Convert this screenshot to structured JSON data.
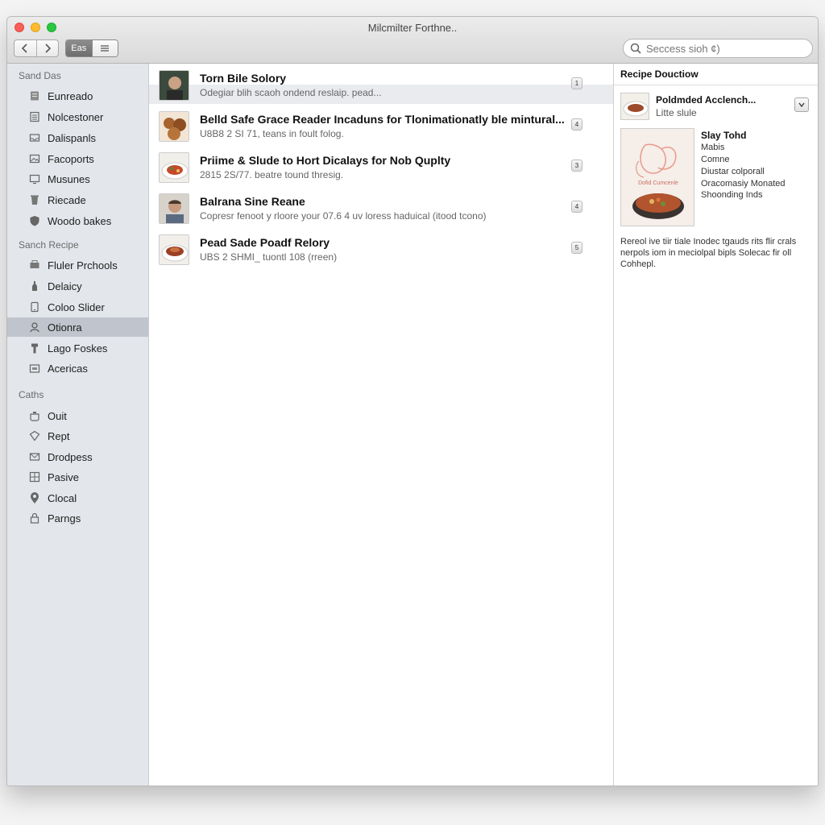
{
  "window": {
    "title": "Milcmilter Forthne.."
  },
  "toolbar": {
    "back_icon": "chevron-left-icon",
    "forward_icon": "chevron-right-icon",
    "view_active_label": "Eas",
    "view_inactive_icon": "list-icon"
  },
  "search": {
    "placeholder": "Seccess sioh ¢)"
  },
  "sidebar": {
    "sections": [
      {
        "header": "Sand Das",
        "items": [
          {
            "label": "Eunreado",
            "icon": "book-icon"
          },
          {
            "label": "Nolcestoner",
            "icon": "document-icon"
          },
          {
            "label": "Dalispanls",
            "icon": "tray-icon"
          },
          {
            "label": "Facoports",
            "icon": "image-icon"
          },
          {
            "label": "Musunes",
            "icon": "monitor-icon"
          },
          {
            "label": "Riecade",
            "icon": "bin-icon"
          },
          {
            "label": "Woodo bakes",
            "icon": "shield-icon"
          }
        ]
      },
      {
        "header": "Sanch Recipe",
        "items": [
          {
            "label": "Fluler Prchools",
            "icon": "printer-icon"
          },
          {
            "label": "Delaicy",
            "icon": "bottle-icon"
          },
          {
            "label": "Coloo Slider",
            "icon": "phone-icon"
          },
          {
            "label": "Otionra",
            "icon": "person-icon",
            "selected": true
          },
          {
            "label": "Lago Foskes",
            "icon": "chef-icon"
          },
          {
            "label": "Acericas",
            "icon": "box-icon"
          }
        ]
      },
      {
        "header": "Caths",
        "items": [
          {
            "label": "Ouit",
            "icon": "pot-icon"
          },
          {
            "label": "Rept",
            "icon": "tag-icon"
          },
          {
            "label": "Drodpess",
            "icon": "mail-icon"
          },
          {
            "label": "Pasive",
            "icon": "grid-icon"
          },
          {
            "label": "Clocal",
            "icon": "pin-icon"
          },
          {
            "label": "Parngs",
            "icon": "lock-icon"
          }
        ]
      }
    ]
  },
  "list": {
    "rows": [
      {
        "title": "Torn Bile Solory",
        "subtitle": "Odegiar blih scaoh ondend reslaip. pead...",
        "badge": "1",
        "thumb": "person",
        "highlight": true
      },
      {
        "title": "Belld Safe Grace Reader Incaduns for Tlonimationatly ble mintural...",
        "subtitle": "U8B8 2 SI 71, teans in foult folog.",
        "badge": "4",
        "thumb": "food-brown"
      },
      {
        "title": "Priime & Slude to Hort Dicalays for Nob Quplty",
        "subtitle": "2815 2S/77. beatre tound thresig.",
        "badge": "3",
        "thumb": "food-plate"
      },
      {
        "title": "Balrana Sine Reane",
        "subtitle": "Copresr fenoot y rloore your 07.6 4 uv loress haduical (itood tcono)",
        "badge": "4",
        "thumb": "person2"
      },
      {
        "title": "Pead Sade Poadf Relory",
        "subtitle": "UBS 2 SHMI_ tuontl 108 (rreen)",
        "badge": "5",
        "thumb": "food-pasta"
      }
    ]
  },
  "detail": {
    "heading": "Recipe Douctiow",
    "item": {
      "title": "Poldmded Acclench...",
      "subtitle": "Litte slule",
      "dropdown_icon": "chevron-down-icon"
    },
    "cover_label": "Dofid Cumcenle",
    "meta": {
      "title": "Slay Tohd",
      "lines": [
        "Mabis",
        "Comne",
        "Diustar colporall",
        "Oracomasiy Monated",
        "Shoonding Inds"
      ]
    },
    "description": "Rereol ive tiir tiale Inodec tgauds rits flir crals nerpols iom in meciolpal bipls Solecac fir oll Cohhepl."
  }
}
